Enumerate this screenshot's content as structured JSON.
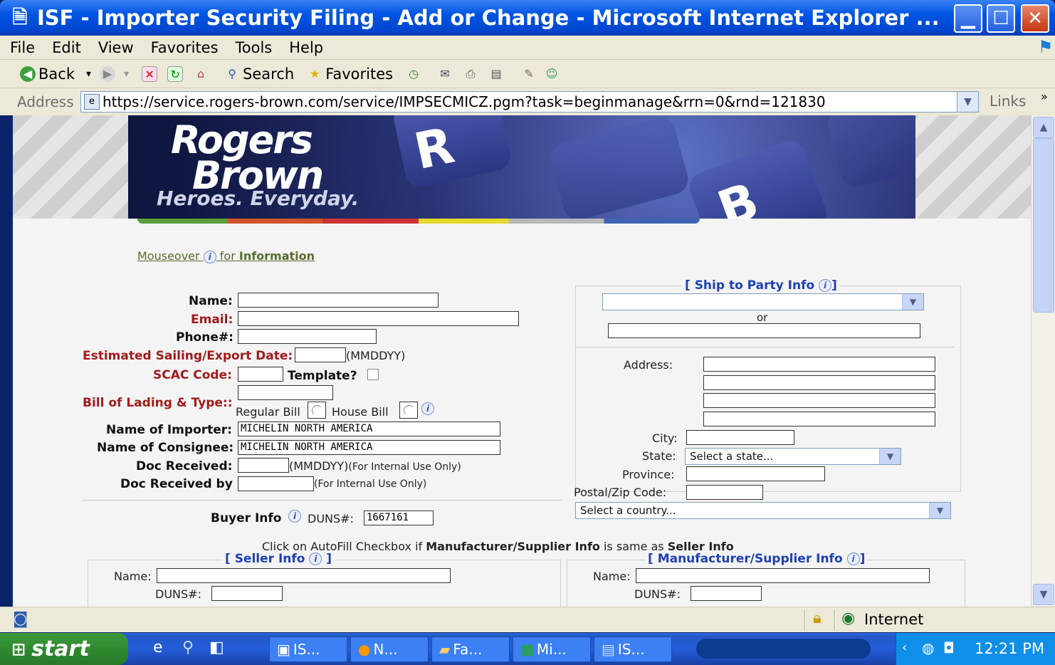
{
  "window": {
    "title": "ISF - Importer Security Filing - Add or Change - Microsoft Internet Explorer ..."
  },
  "menu": [
    "File",
    "Edit",
    "View",
    "Favorites",
    "Tools",
    "Help"
  ],
  "toolbar": {
    "back": "Back",
    "search": "Search",
    "favorites": "Favorites"
  },
  "address": {
    "label": "Address",
    "url": "https://service.rogers-brown.com/service/IMPSECMICZ.pgm?task=beginmanage&rrn=0&rnd=121830",
    "links": "Links"
  },
  "banner": {
    "logo_line1": "Rogers",
    "logo_line2": "Brown",
    "tagline": "Heroes. Everyday.",
    "key_r": "R",
    "key_b": "B"
  },
  "help_link": {
    "prefix": "Mouseover ",
    "suffix": " for ",
    "bold": "Information"
  },
  "form": {
    "name_label": "Name:",
    "email_label": "Email:",
    "phone_label": "Phone#:",
    "sail_label": "Estimated Sailing/Export Date:",
    "sail_hint": "(MMDDYY)",
    "scac_label": "SCAC Code:",
    "template_label": "Template?",
    "bol_label": "Bill of Lading & Type::",
    "regular_bill": "Regular Bill",
    "house_bill": "House Bill",
    "importer_label": "Name of Importer:",
    "importer_value": "MICHELIN NORTH AMERICA",
    "consignee_label": "Name of Consignee:",
    "consignee_value": "MICHELIN NORTH AMERICA",
    "doc_received_label": "Doc Received:",
    "doc_received_hint": "(MMDDYY)",
    "doc_received_note": "(For Internal Use Only)",
    "doc_received_by_label": "Doc Received by",
    "doc_received_by_note": "(For Internal Use Only)",
    "buyer_label": "Buyer Info",
    "duns_label": "DUNS#:",
    "duns_value": "1667161",
    "autofill_pre": "Click on AutoFill Checkbox if ",
    "autofill_b1": "Manufacturer/Supplier Info",
    "autofill_mid": " is same as ",
    "autofill_b2": "Seller Info"
  },
  "ship_to": {
    "title": "[ Ship to Party Info",
    "title_end": "]",
    "or": "or",
    "address_label": "Address:",
    "city_label": "City:",
    "state_label": "State:",
    "state_value": "Select a state...",
    "province_label": "Province:",
    "postal_label": "Postal/Zip Code:",
    "country_value": "Select a country..."
  },
  "seller": {
    "title": "[ Seller Info",
    "title_end": "]",
    "name_label": "Name:",
    "duns_label": "DUNS#:"
  },
  "manufacturer": {
    "title": "[ Manufacturer/Supplier Info",
    "title_end": "]",
    "name_label": "Name:",
    "duns_label": "DUNS#:"
  },
  "status": {
    "zone": "Internet"
  },
  "taskbar": {
    "start": "start",
    "tasks": [
      "IS...",
      "N...",
      "Fa...",
      "Mi...",
      "IS..."
    ],
    "clock": "12:21 PM"
  }
}
